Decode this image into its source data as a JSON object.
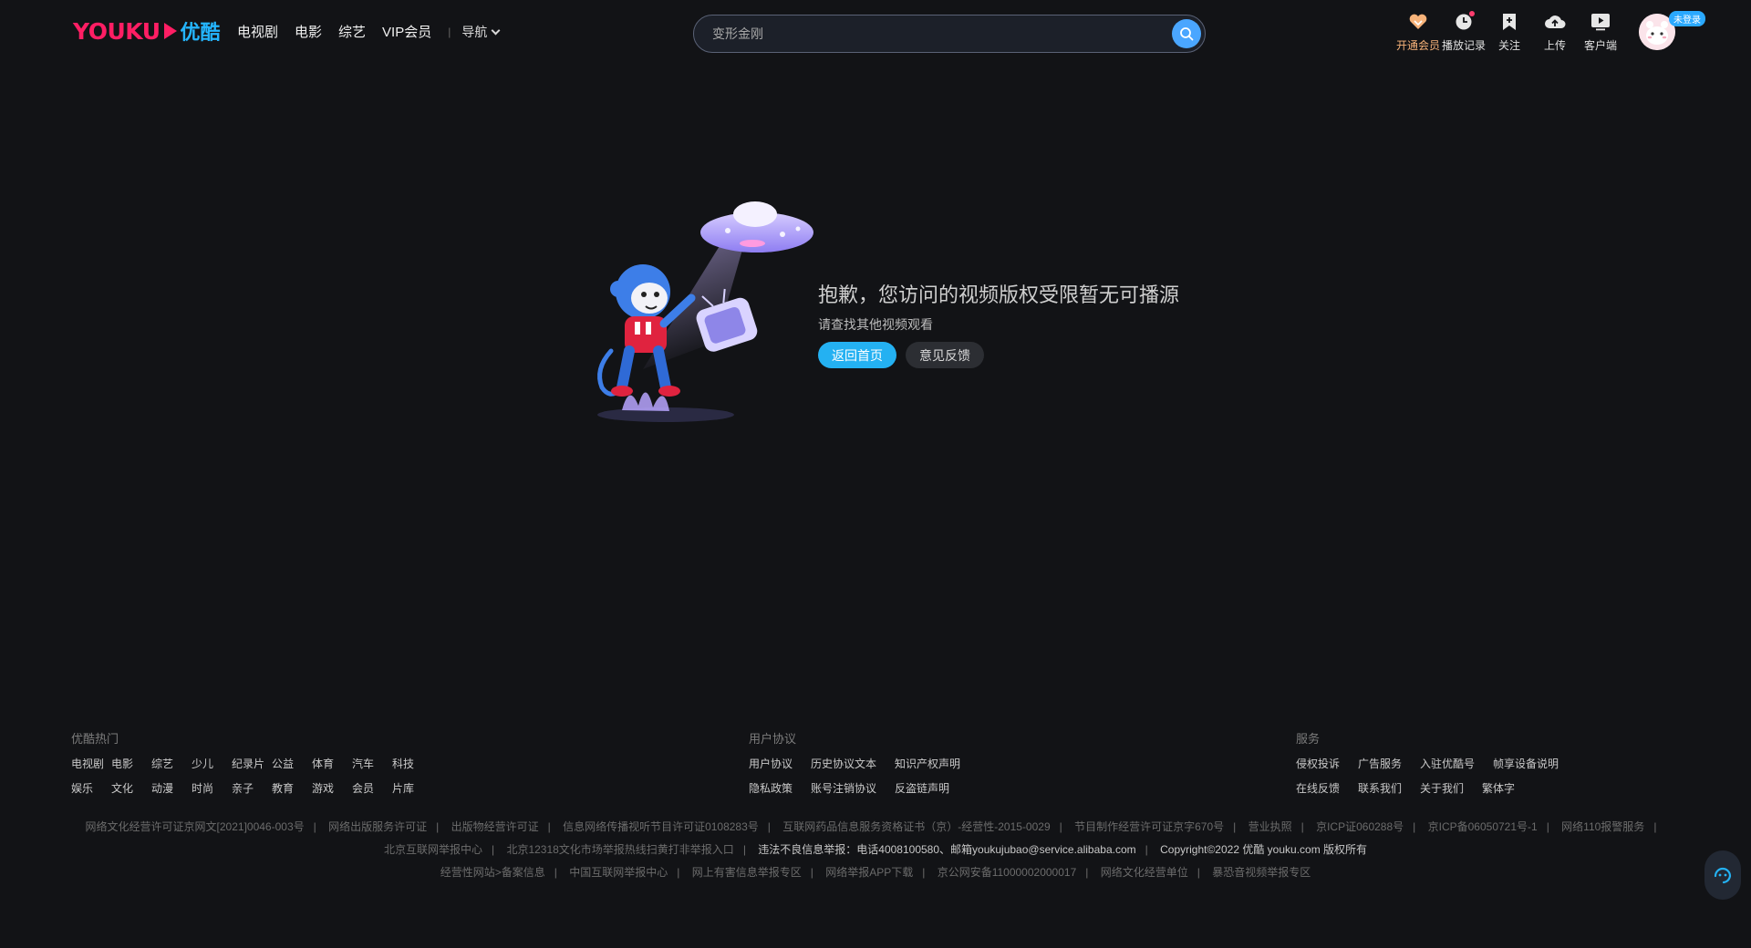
{
  "header": {
    "logo_text": "YOUKU",
    "logo_cn": "优酷",
    "nav": [
      "电视剧",
      "电影",
      "综艺",
      "VIP会员"
    ],
    "nav_menu": "导航",
    "search_placeholder": "变形金刚",
    "tools": [
      {
        "label": "开通会员",
        "icon": "vip-heart-icon"
      },
      {
        "label": "播放记录",
        "icon": "history-clock-icon"
      },
      {
        "label": "关注",
        "icon": "follow-bookmark-icon"
      },
      {
        "label": "上传",
        "icon": "upload-cloud-icon"
      },
      {
        "label": "客户端",
        "icon": "client-play-icon"
      }
    ],
    "login_badge": "未登录"
  },
  "error": {
    "title": "抱歉，您访问的视频版权受限暂无可播源",
    "subtitle": "请查找其他视频观看",
    "home_button": "返回首页",
    "feedback_button": "意见反馈"
  },
  "footer": {
    "hot": {
      "title": "优酷热门",
      "row1": [
        "电视剧",
        "电影",
        "综艺",
        "少儿",
        "纪录片",
        "公益",
        "体育",
        "汽车",
        "科技"
      ],
      "row2": [
        "娱乐",
        "文化",
        "动漫",
        "时尚",
        "亲子",
        "教育",
        "游戏",
        "会员",
        "片库"
      ]
    },
    "agreement": {
      "title": "用户协议",
      "row1": [
        "用户协议",
        "历史协议文本",
        "知识产权声明"
      ],
      "row2": [
        "隐私政策",
        "账号注销协议",
        "反盗链声明"
      ]
    },
    "service": {
      "title": "服务",
      "row1": [
        "侵权投诉",
        "广告服务",
        "入驻优酷号",
        "帧享设备说明"
      ],
      "row2": [
        "在线反馈",
        "联系我们",
        "关于我们",
        "繁体字"
      ]
    },
    "license_row1": [
      "网络文化经营许可证京网文[2021]0046-003号",
      "网络出版服务许可证",
      "出版物经营许可证",
      "信息网络传播视听节目许可证0108283号",
      "互联网药品信息服务资格证书（京）-经营性-2015-0029",
      "节目制作经营许可证京字670号",
      "营业执照",
      "京ICP证060288号",
      "京ICP备06050721号-1",
      "网络110报警服务",
      ""
    ],
    "license_row2": [
      "北京互联网举报中心",
      "北京12318文化市场举报热线扫黄打非举报入口"
    ],
    "report_text": "违法不良信息举报：电话4008100580、邮箱youkujubao@service.alibaba.com",
    "copyright": "Copyright©2022 优酷 youku.com 版权所有",
    "license_row3": [
      "经营性网站>备案信息",
      "中国互联网举报中心",
      "网上有害信息举报专区",
      "网络举报APP下载",
      "京公网安备11000002000017",
      "网络文化经营单位",
      "暴恐音视频举报专区"
    ]
  }
}
